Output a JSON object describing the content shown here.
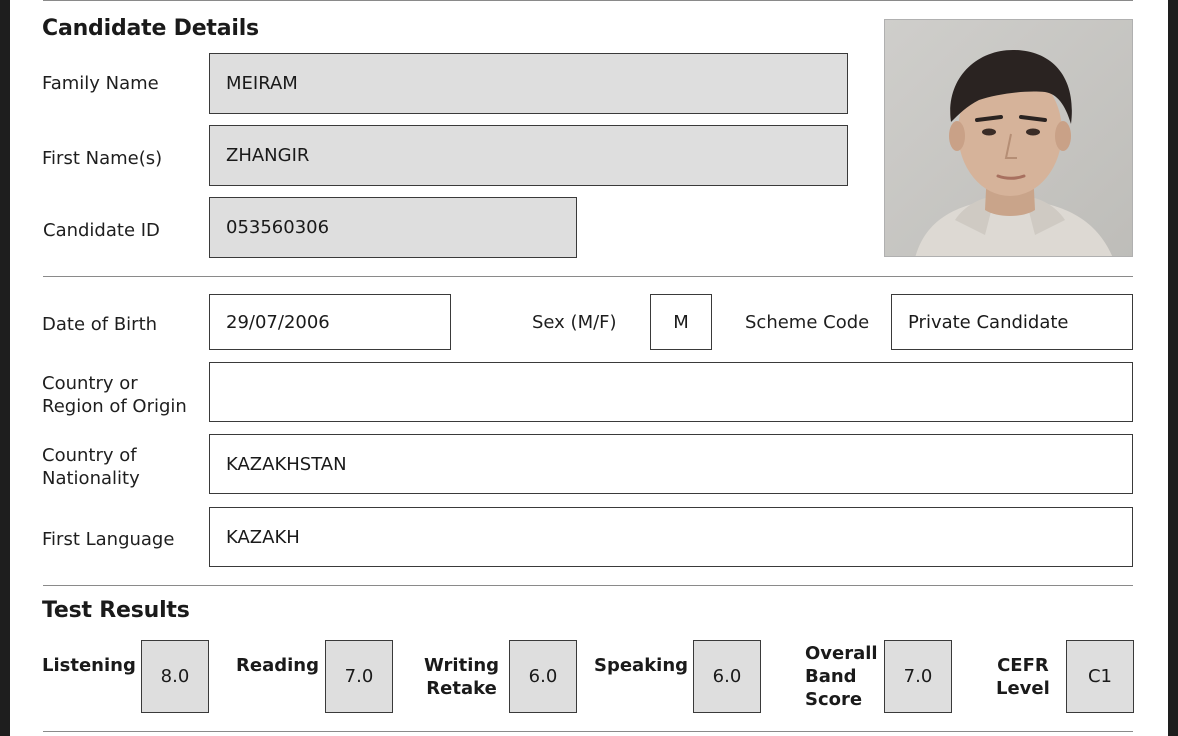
{
  "candidate": {
    "heading": "Candidate Details",
    "family_name_label": "Family Name",
    "family_name": "MEIRAM",
    "first_name_label": "First Name(s)",
    "first_name": "ZHANGIR",
    "candidate_id_label": "Candidate ID",
    "candidate_id": "053560306",
    "photo_icon": "candidate-photo"
  },
  "personal": {
    "dob_label": "Date of Birth",
    "dob": "29/07/2006",
    "sex_label": "Sex (M/F)",
    "sex": "M",
    "scheme_label": "Scheme Code",
    "scheme": "Private Candidate",
    "origin_label_1": "Country or",
    "origin_label_2": "Region of Origin",
    "origin": "",
    "nationality_label_1": "Country of",
    "nationality_label_2": "Nationality",
    "nationality": "KAZAKHSTAN",
    "language_label": "First Language",
    "language": "KAZAKH"
  },
  "results": {
    "heading": "Test Results",
    "listening_label": "Listening",
    "listening": "8.0",
    "reading_label": "Reading",
    "reading": "7.0",
    "writing_label_1": "Writing",
    "writing_label_2": "Retake",
    "writing": "6.0",
    "speaking_label": "Speaking",
    "speaking": "6.0",
    "overall_label_1": "Overall",
    "overall_label_2": "Band",
    "overall_label_3": "Score",
    "overall": "7.0",
    "cefr_label_1": "CEFR",
    "cefr_label_2": "Level",
    "cefr": "C1"
  },
  "colors": {
    "field_shade": "#dedede",
    "border": "#3a3a3a",
    "rule": "#8a8a8a"
  }
}
